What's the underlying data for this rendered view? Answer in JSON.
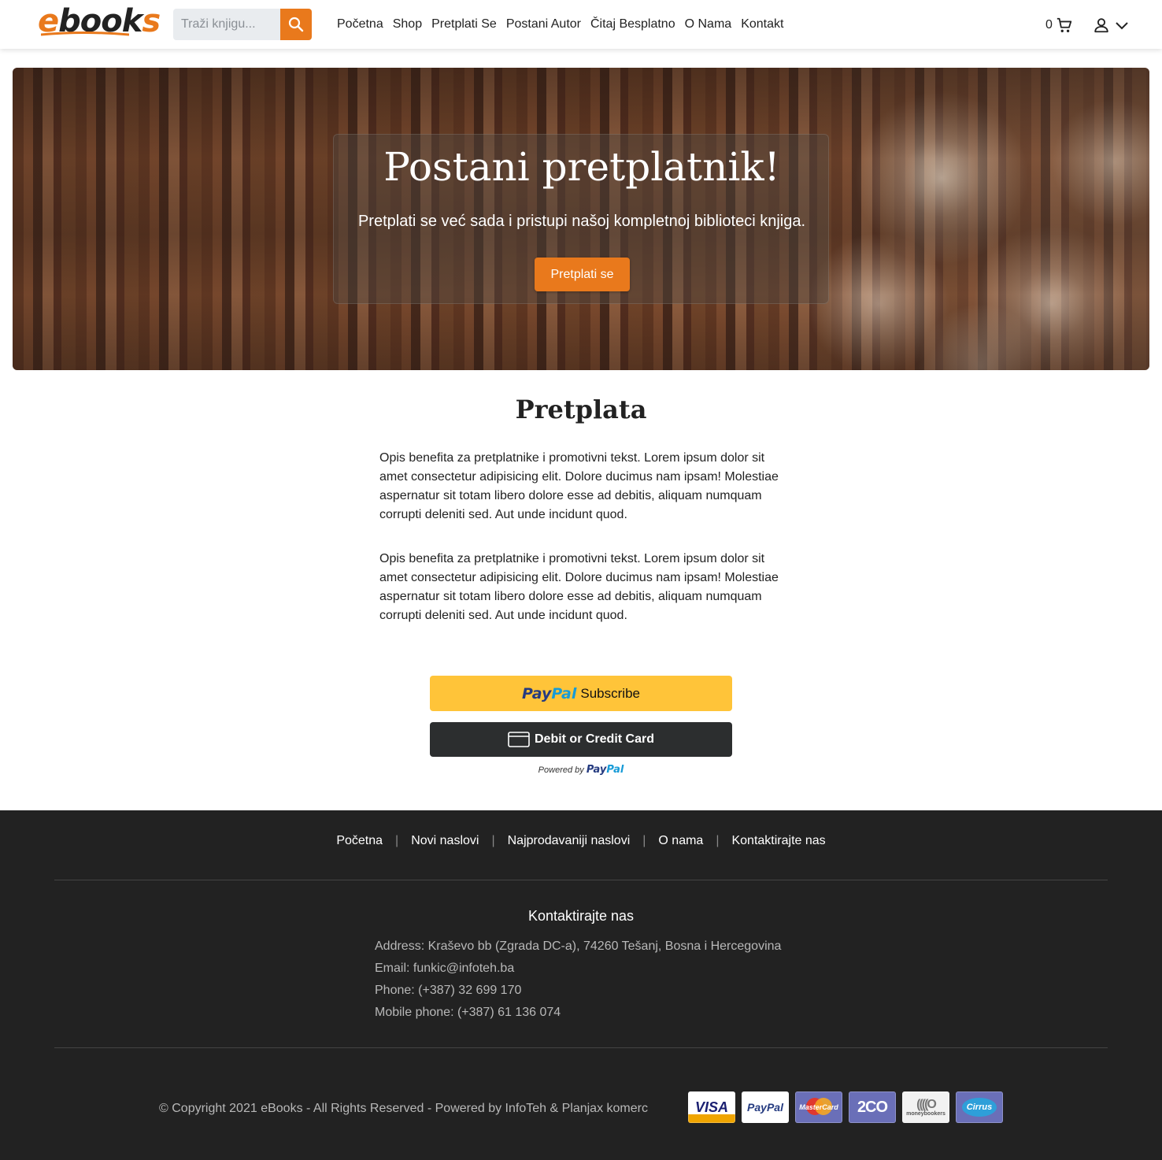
{
  "header": {
    "logo": "ebooks",
    "search_placeholder": "Traži knjigu...",
    "nav": [
      "Početna",
      "Shop",
      "Pretplati Se",
      "Postani Autor",
      "Čitaj Besplatno",
      "O Nama",
      "Kontakt"
    ],
    "cart_count": "0"
  },
  "hero": {
    "title": "Postani pretplatnik!",
    "subtitle": "Pretplati se već sada i pristupi našoj kompletnoj biblioteci knjiga.",
    "button": "Pretplati se"
  },
  "main": {
    "title": "Pretplata",
    "paragraphs": [
      "Opis benefita za pretplatnike i promotivni tekst. Lorem ipsum dolor sit amet consectetur adipisicing elit. Dolore ducimus nam ipsam! Molestiae aspernatur sit totam libero dolore esse ad debitis, aliquam numquam corrupti deleniti sed. Aut unde incidunt quod.",
      "Opis benefita za pretplatnike i promotivni tekst. Lorem ipsum dolor sit amet consectetur adipisicing elit. Dolore ducimus nam ipsam! Molestiae aspernatur sit totam libero dolore esse ad debitis, aliquam numquam corrupti deleniti sed. Aut unde incidunt quod."
    ],
    "paypal": {
      "pay": "Pay",
      "pal": "Pal",
      "subscribe": "Subscribe",
      "card_button": "Debit or Credit Card",
      "powered_by": "Powered by"
    }
  },
  "footer": {
    "links": [
      "Početna",
      "Novi naslovi",
      "Najprodavaniji naslovi",
      "O nama",
      "Kontaktirajte nas"
    ],
    "separator": "|",
    "contact_title": "Kontaktirajte nas",
    "address": "Address: Kraševo bb (Zgrada DC-a), 74260 Tešanj, Bosna i Hercegovina",
    "email": "Email: funkic@infoteh.ba",
    "phone": "Phone: (+387) 32 699 170",
    "mobile": "Mobile phone: (+387) 61 136 074",
    "copyright": "© Copyright 2021 eBooks - All Rights Reserved - Powered by InfoTeh & Planjax komerc",
    "payment_cards": {
      "visa": "VISA",
      "paypal": "PayPal",
      "mastercard": "MasterCard",
      "twoco": "2CO",
      "moneybookers": "moneybookers",
      "cirrus": "Cirrus"
    }
  },
  "colors": {
    "accent": "#e9791c",
    "footer_bg": "#222222",
    "paypal_yellow": "#ffc439"
  }
}
